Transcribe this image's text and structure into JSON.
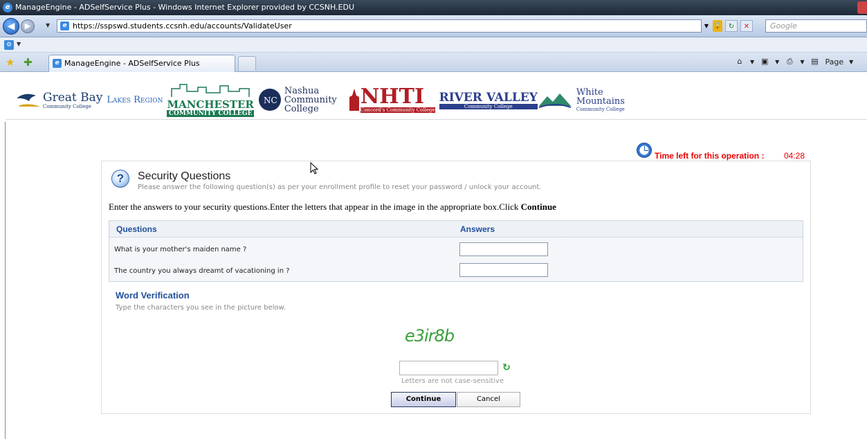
{
  "window": {
    "title": "ManageEngine - ADSelfService Plus - Windows Internet Explorer provided by CCSNH.EDU"
  },
  "address_bar": {
    "url": "https://sspswd.students.ccsnh.edu/accounts/ValidateUser",
    "search_placeholder": "Google"
  },
  "tab": {
    "title": "ManageEngine - ADSelfService Plus"
  },
  "command_bar": {
    "page_label": "Page"
  },
  "logos": [
    {
      "name": "Great Bay",
      "sub": "Community College"
    },
    {
      "name": "Lakes Region",
      "sub": "Community College"
    },
    {
      "name": "Manchester",
      "sub": "Community College"
    },
    {
      "name": "Nashua Community College",
      "sub": ""
    },
    {
      "name": "NHTI",
      "sub": "Concord's Community College"
    },
    {
      "name": "River Valley",
      "sub": "Community College"
    },
    {
      "name": "White Mountains",
      "sub": "Community College"
    }
  ],
  "timer": {
    "label": "Time left for this operation :",
    "value": "04:28"
  },
  "security": {
    "title": "Security Questions",
    "description": "Please answer the following question(s) as per your enrollment profile to reset your password / unlock your account.",
    "instructions_prefix": "Enter the answers to your security questions.Enter the letters that appear in the image in the appropriate box.Click ",
    "instructions_bold": "Continue",
    "table": {
      "col_questions": "Questions",
      "col_answers": "Answers",
      "rows": [
        {
          "question": "What is your mother's maiden name ?",
          "answer": ""
        },
        {
          "question": "The country you always dreamt of vacationing in ?",
          "answer": ""
        }
      ]
    }
  },
  "word_verification": {
    "title": "Word Verification",
    "description": "Type the characters you see in the picture below.",
    "captcha_text": "e3ir8b",
    "input_value": "",
    "case_note": "Letters are not case-sensitive"
  },
  "buttons": {
    "continue": "Continue",
    "cancel": "Cancel"
  },
  "colors": {
    "timer_red": "#ee0000",
    "heading_blue": "#1f4f9a",
    "captcha_green": "#3aa03a"
  }
}
